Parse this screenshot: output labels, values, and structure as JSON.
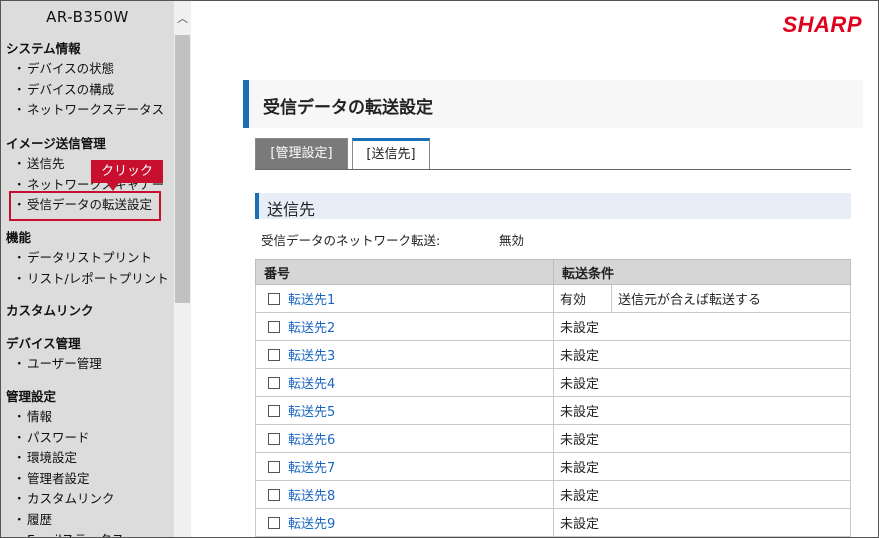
{
  "sidebar": {
    "model": "AR-B350W",
    "sections": [
      {
        "title": "システム情報",
        "items": [
          "デバイスの状態",
          "デバイスの構成",
          "ネットワークステータス"
        ]
      },
      {
        "title": "イメージ送信管理",
        "items": [
          "送信先",
          "ネットワークスキャナー",
          "受信データの転送設定"
        ]
      },
      {
        "title": "機能",
        "items": [
          "データリストプリント",
          "リスト/レポートプリント"
        ]
      },
      {
        "title": "カスタムリンク",
        "items": []
      },
      {
        "title": "デバイス管理",
        "items": [
          "ユーザー管理"
        ]
      },
      {
        "title": "管理設定",
        "items": [
          "情報",
          "パスワード",
          "環境設定",
          "管理者設定",
          "カスタムリンク",
          "履歴",
          "Emailステータス"
        ]
      }
    ],
    "callout": "クリック",
    "highlighted_item": "受信データの転送設定"
  },
  "header": {
    "brand": "SHARP",
    "page_title": "受信データの転送設定"
  },
  "tabs": [
    {
      "label": "[管理設定]",
      "selected": false
    },
    {
      "label": "[送信先]",
      "selected": true
    }
  ],
  "section": {
    "title": "送信先",
    "forward_label": "受信データのネットワーク転送:",
    "forward_value": "無効"
  },
  "table": {
    "headers": [
      "番号",
      "転送条件"
    ],
    "rows": [
      {
        "name": "転送先1",
        "status": "有効",
        "condition": "送信元が合えば転送する"
      },
      {
        "name": "転送先2",
        "status": "未設定",
        "condition": ""
      },
      {
        "name": "転送先3",
        "status": "未設定",
        "condition": ""
      },
      {
        "name": "転送先4",
        "status": "未設定",
        "condition": ""
      },
      {
        "name": "転送先5",
        "status": "未設定",
        "condition": ""
      },
      {
        "name": "転送先6",
        "status": "未設定",
        "condition": ""
      },
      {
        "name": "転送先7",
        "status": "未設定",
        "condition": ""
      },
      {
        "name": "転送先8",
        "status": "未設定",
        "condition": ""
      },
      {
        "name": "転送先9",
        "status": "未設定",
        "condition": ""
      }
    ]
  },
  "colors": {
    "accent": "#1a6fb5",
    "brand": "#e0001b",
    "callout": "#c8102e",
    "link": "#1a66c2"
  }
}
